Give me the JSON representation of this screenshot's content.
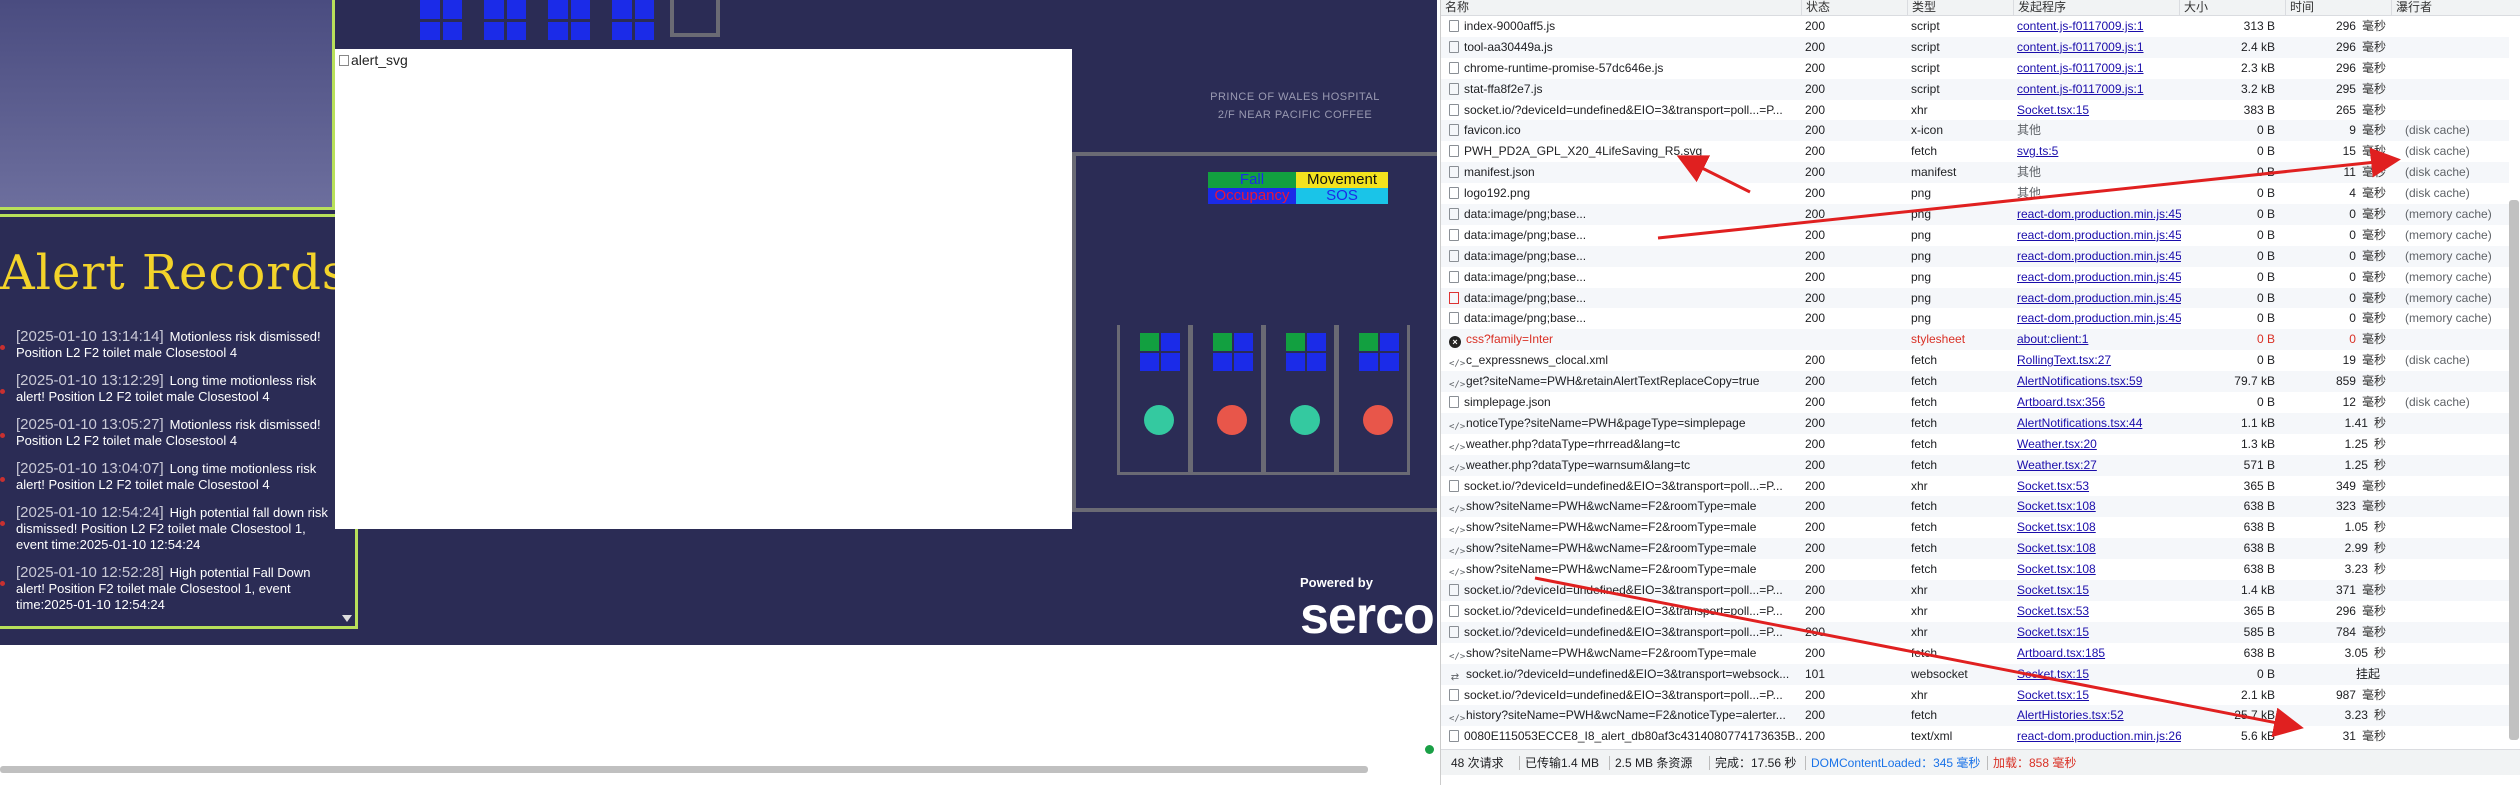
{
  "app": {
    "alert_records_title": "Alert Records",
    "alert_image_alt": "alert_svg",
    "hospital_label_line1": "PRINCE OF WALES HOSPITAL",
    "hospital_label_line2": "2/F NEAR PACIFIC COFFEE",
    "legend": {
      "fall": "Fall",
      "movement": "Movement",
      "occupancy": "Occupancy",
      "sos": "SOS"
    },
    "powered_by": "Powered by",
    "brand": "serco",
    "records": [
      {
        "time": "[2025-01-10 13:14:14]",
        "text": "Motionless risk dismissed! Position L2 F2 toilet male Closestool 4"
      },
      {
        "time": "[2025-01-10 13:12:29]",
        "text": "Long time motionless risk alert! Position L2 F2 toilet male Closestool 4"
      },
      {
        "time": "[2025-01-10 13:05:27]",
        "text": "Motionless risk dismissed! Position L2 F2 toilet male Closestool 4"
      },
      {
        "time": "[2025-01-10 13:04:07]",
        "text": "Long time motionless risk alert! Position L2 F2 toilet male Closestool 4"
      },
      {
        "time": "[2025-01-10 12:54:24]",
        "text": "High potential fall down risk dismissed! Position L2 F2 toilet male Closestool 1, event time:2025-01-10 12:54:24"
      },
      {
        "time": "[2025-01-10 12:52:28]",
        "text": "High potential Fall Down alert! Position F2 toilet male Closestool 1, event time:2025-01-10 12:54:24"
      }
    ],
    "colors": {
      "background": "#2b2c55",
      "accent_border": "#b8e05a",
      "title": "#f3d32a",
      "occupied_blue": "#1b2be8",
      "free_green": "#12a040",
      "ball_teal": "#34c9a0",
      "ball_red": "#e8564a"
    }
  },
  "network": {
    "headers": {
      "name": "名称",
      "status": "状态",
      "type": "类型",
      "initiator": "发起程序",
      "size": "大小",
      "time": "时间",
      "waterfall": "瀑行者"
    },
    "rows": [
      {
        "icon": "doc",
        "name": "index-9000aff5.js",
        "status": "200",
        "type": "script",
        "initiator": "content.js-f0117009.js:1",
        "size": "313 B",
        "time": "296",
        "unit": "毫秒",
        "extra": ""
      },
      {
        "icon": "doc",
        "name": "tool-aa30449a.js",
        "status": "200",
        "type": "script",
        "initiator": "content.js-f0117009.js:1",
        "size": "2.4 kB",
        "time": "296",
        "unit": "毫秒",
        "extra": ""
      },
      {
        "icon": "doc",
        "name": "chrome-runtime-promise-57dc646e.js",
        "status": "200",
        "type": "script",
        "initiator": "content.js-f0117009.js:1",
        "size": "2.3 kB",
        "time": "296",
        "unit": "毫秒",
        "extra": ""
      },
      {
        "icon": "doc",
        "name": "stat-ffa8f2e7.js",
        "status": "200",
        "type": "script",
        "initiator": "content.js-f0117009.js:1",
        "size": "3.2 kB",
        "time": "295",
        "unit": "毫秒",
        "extra": ""
      },
      {
        "icon": "doc",
        "name": "socket.io/?deviceId=undefined&EIO=3&transport=poll...=P...",
        "status": "200",
        "type": "xhr",
        "initiator": "Socket.tsx:15",
        "size": "383 B",
        "time": "265",
        "unit": "毫秒",
        "extra": ""
      },
      {
        "icon": "doc",
        "name": "favicon.ico",
        "status": "200",
        "type": "x-icon",
        "initiator": "其他",
        "size": "0 B",
        "time": "9",
        "unit": "毫秒",
        "extra": "(disk cache)",
        "plain": true
      },
      {
        "icon": "doc",
        "name": "PWH_PD2A_GPL_X20_4LifeSaving_R5.svg",
        "status": "200",
        "type": "fetch",
        "initiator": "svg.ts:5",
        "size": "0 B",
        "time": "15",
        "unit": "毫秒",
        "extra": "(disk cache)"
      },
      {
        "icon": "doc",
        "name": "manifest.json",
        "status": "200",
        "type": "manifest",
        "initiator": "其他",
        "size": "0 B",
        "time": "11",
        "unit": "毫秒",
        "extra": "(disk cache)",
        "plain": true
      },
      {
        "icon": "doc",
        "name": "logo192.png",
        "status": "200",
        "type": "png",
        "initiator": "其他",
        "size": "0 B",
        "time": "4",
        "unit": "毫秒",
        "extra": "(disk cache)",
        "plain": true
      },
      {
        "icon": "doc",
        "name": "data:image/png;base...",
        "status": "200",
        "type": "png",
        "initiator": "react-dom.production.min.js:45",
        "size": "0 B",
        "time": "0",
        "unit": "毫秒",
        "extra": "(memory cache)"
      },
      {
        "icon": "doc",
        "name": "data:image/png;base...",
        "status": "200",
        "type": "png",
        "initiator": "react-dom.production.min.js:45",
        "size": "0 B",
        "time": "0",
        "unit": "毫秒",
        "extra": "(memory cache)"
      },
      {
        "icon": "doc",
        "name": "data:image/png;base...",
        "status": "200",
        "type": "png",
        "initiator": "react-dom.production.min.js:45",
        "size": "0 B",
        "time": "0",
        "unit": "毫秒",
        "extra": "(memory cache)"
      },
      {
        "icon": "doc",
        "name": "data:image/png;base...",
        "status": "200",
        "type": "png",
        "initiator": "react-dom.production.min.js:45",
        "size": "0 B",
        "time": "0",
        "unit": "毫秒",
        "extra": "(memory cache)"
      },
      {
        "icon": "img",
        "name": "data:image/png;base...",
        "status": "200",
        "type": "png",
        "initiator": "react-dom.production.min.js:45",
        "size": "0 B",
        "time": "0",
        "unit": "毫秒",
        "extra": "(memory cache)"
      },
      {
        "icon": "doc",
        "name": "data:image/png;base...",
        "status": "200",
        "type": "png",
        "initiator": "react-dom.production.min.js:45",
        "size": "0 B",
        "time": "0",
        "unit": "毫秒",
        "extra": "(memory cache)"
      },
      {
        "icon": "err",
        "name": "css?family=Inter",
        "status": "",
        "type": "stylesheet",
        "initiator": "about:client:1",
        "size": "0 B",
        "time": "0",
        "unit": "毫秒",
        "extra": "",
        "red": true
      },
      {
        "icon": "code",
        "name": "c_expressnews_clocal.xml",
        "status": "200",
        "type": "fetch",
        "initiator": "RollingText.tsx:27",
        "size": "0 B",
        "time": "19",
        "unit": "毫秒",
        "extra": "(disk cache)"
      },
      {
        "icon": "code",
        "name": "get?siteName=PWH&retainAlertTextReplaceCopy=true",
        "status": "200",
        "type": "fetch",
        "initiator": "AlertNotifications.tsx:59",
        "size": "79.7 kB",
        "time": "859",
        "unit": "毫秒",
        "extra": ""
      },
      {
        "icon": "doc",
        "name": "simplepage.json",
        "status": "200",
        "type": "fetch",
        "initiator": "Artboard.tsx:356",
        "size": "0 B",
        "time": "12",
        "unit": "毫秒",
        "extra": "(disk cache)"
      },
      {
        "icon": "code",
        "name": "noticeType?siteName=PWH&pageType=simplepage",
        "status": "200",
        "type": "fetch",
        "initiator": "AlertNotifications.tsx:44",
        "size": "1.1 kB",
        "time": "1.41",
        "unit": "秒",
        "extra": ""
      },
      {
        "icon": "code",
        "name": "weather.php?dataType=rhrread&lang=tc",
        "status": "200",
        "type": "fetch",
        "initiator": "Weather.tsx:20",
        "size": "1.3 kB",
        "time": "1.25",
        "unit": "秒",
        "extra": ""
      },
      {
        "icon": "code",
        "name": "weather.php?dataType=warnsum&lang=tc",
        "status": "200",
        "type": "fetch",
        "initiator": "Weather.tsx:27",
        "size": "571 B",
        "time": "1.25",
        "unit": "秒",
        "extra": ""
      },
      {
        "icon": "doc",
        "name": "socket.io/?deviceId=undefined&EIO=3&transport=poll...=P...",
        "status": "200",
        "type": "xhr",
        "initiator": "Socket.tsx:53",
        "size": "365 B",
        "time": "349",
        "unit": "毫秒",
        "extra": ""
      },
      {
        "icon": "code",
        "name": "show?siteName=PWH&wcName=F2&roomType=male",
        "status": "200",
        "type": "fetch",
        "initiator": "Socket.tsx:108",
        "size": "638 B",
        "time": "323",
        "unit": "毫秒",
        "extra": ""
      },
      {
        "icon": "code",
        "name": "show?siteName=PWH&wcName=F2&roomType=male",
        "status": "200",
        "type": "fetch",
        "initiator": "Socket.tsx:108",
        "size": "638 B",
        "time": "1.05",
        "unit": "秒",
        "extra": ""
      },
      {
        "icon": "code",
        "name": "show?siteName=PWH&wcName=F2&roomType=male",
        "status": "200",
        "type": "fetch",
        "initiator": "Socket.tsx:108",
        "size": "638 B",
        "time": "2.99",
        "unit": "秒",
        "extra": ""
      },
      {
        "icon": "code",
        "name": "show?siteName=PWH&wcName=F2&roomType=male",
        "status": "200",
        "type": "fetch",
        "initiator": "Socket.tsx:108",
        "size": "638 B",
        "time": "3.23",
        "unit": "秒",
        "extra": ""
      },
      {
        "icon": "doc",
        "name": "socket.io/?deviceId=undefined&EIO=3&transport=poll...=P...",
        "status": "200",
        "type": "xhr",
        "initiator": "Socket.tsx:15",
        "size": "1.4 kB",
        "time": "371",
        "unit": "毫秒",
        "extra": ""
      },
      {
        "icon": "doc",
        "name": "socket.io/?deviceId=undefined&EIO=3&transport=poll...=P...",
        "status": "200",
        "type": "xhr",
        "initiator": "Socket.tsx:53",
        "size": "365 B",
        "time": "296",
        "unit": "毫秒",
        "extra": ""
      },
      {
        "icon": "doc",
        "name": "socket.io/?deviceId=undefined&EIO=3&transport=poll...=P...",
        "status": "200",
        "type": "xhr",
        "initiator": "Socket.tsx:15",
        "size": "585 B",
        "time": "784",
        "unit": "毫秒",
        "extra": ""
      },
      {
        "icon": "code",
        "name": "show?siteName=PWH&wcName=F2&roomType=male",
        "status": "200",
        "type": "fetch",
        "initiator": "Artboard.tsx:185",
        "size": "638 B",
        "time": "3.05",
        "unit": "秒",
        "extra": ""
      },
      {
        "icon": "ws",
        "name": "socket.io/?deviceId=undefined&EIO=3&transport=websock...",
        "status": "101",
        "type": "websocket",
        "initiator": "Socket.tsx:15",
        "size": "0 B",
        "time": "挂起",
        "unit": "",
        "extra": ""
      },
      {
        "icon": "doc",
        "name": "socket.io/?deviceId=undefined&EIO=3&transport=poll...=P...",
        "status": "200",
        "type": "xhr",
        "initiator": "Socket.tsx:15",
        "size": "2.1 kB",
        "time": "987",
        "unit": "毫秒",
        "extra": ""
      },
      {
        "icon": "code",
        "name": "history?siteName=PWH&wcName=F2&noticeType=alerter...",
        "status": "200",
        "type": "fetch",
        "initiator": "AlertHistories.tsx:52",
        "size": "25.7 kB",
        "time": "3.23",
        "unit": "秒",
        "extra": ""
      },
      {
        "icon": "doc",
        "name": "0080E115053ECCE8_I8_alert_db80af3c4314080774173635B...",
        "status": "200",
        "type": "text/xml",
        "initiator": "react-dom.production.min.js:262",
        "size": "5.6 kB",
        "time": "31",
        "unit": "毫秒",
        "extra": ""
      }
    ],
    "footer": {
      "requests": "48 次请求",
      "transferred": "已传输1.4 MB",
      "resources": "2.5 MB 条资源",
      "finish": "完成：17.56 秒",
      "dcl": "DOMContentLoaded：345 毫秒",
      "load": "加载：858 毫秒"
    }
  }
}
